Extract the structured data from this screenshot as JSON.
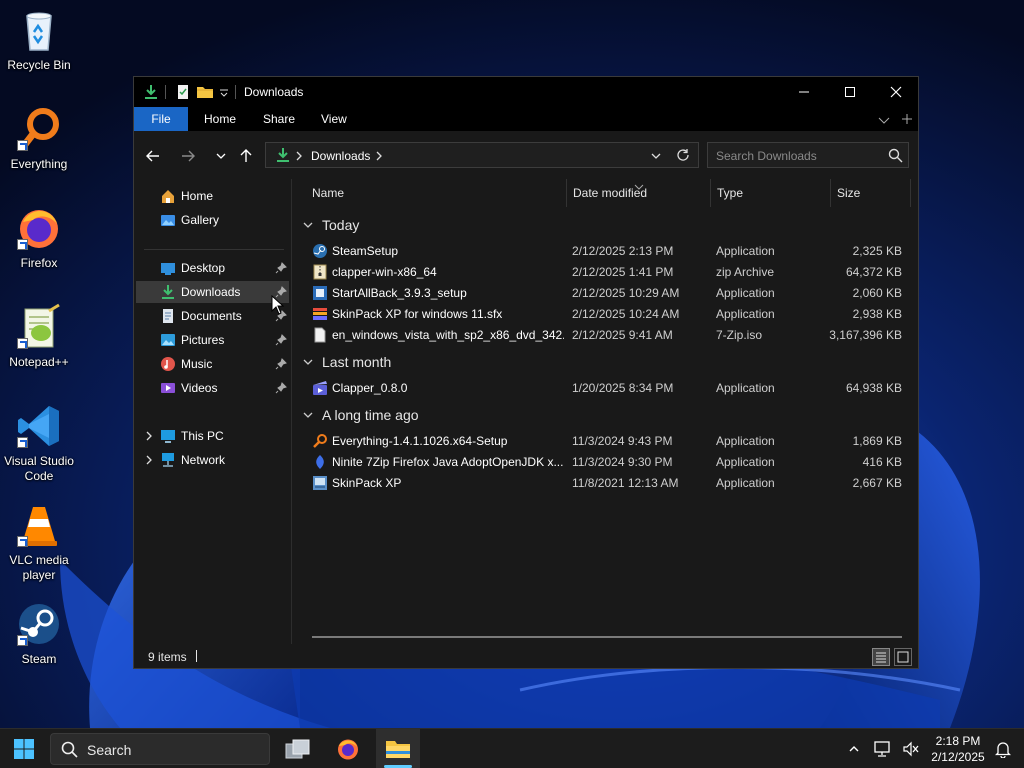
{
  "desktop": {
    "icons": [
      {
        "label": "Recycle Bin",
        "icon": "recycle-bin-icon"
      },
      {
        "label": "Everything",
        "icon": "everything-icon"
      },
      {
        "label": "Firefox",
        "icon": "firefox-icon"
      },
      {
        "label": "Notepad++",
        "icon": "notepad-plus-plus-icon"
      },
      {
        "label": "Visual Studio Code",
        "icon": "vscode-icon"
      },
      {
        "label": "VLC media player",
        "icon": "vlc-icon"
      },
      {
        "label": "Steam",
        "icon": "steam-icon"
      }
    ]
  },
  "window": {
    "title": "Downloads",
    "controls": {
      "minimize": "minimize-icon",
      "maximize": "maximize-icon",
      "close": "close-icon"
    }
  },
  "ribbon": {
    "tabs": [
      "File",
      "Home",
      "Share",
      "View"
    ]
  },
  "address": {
    "path": [
      "Downloads"
    ],
    "search_placeholder": "Search Downloads"
  },
  "nav": {
    "items": [
      {
        "label": "Home",
        "icon": "home-icon"
      },
      {
        "label": "Gallery",
        "icon": "gallery-icon"
      },
      {
        "label": "Desktop",
        "icon": "desktop-folder-icon",
        "pinned": true
      },
      {
        "label": "Downloads",
        "icon": "downloads-folder-icon",
        "pinned": true,
        "selected": true
      },
      {
        "label": "Documents",
        "icon": "documents-folder-icon",
        "pinned": true
      },
      {
        "label": "Pictures",
        "icon": "pictures-folder-icon",
        "pinned": true
      },
      {
        "label": "Music",
        "icon": "music-folder-icon",
        "pinned": true
      },
      {
        "label": "Videos",
        "icon": "videos-folder-icon",
        "pinned": true
      },
      {
        "label": "This PC",
        "icon": "this-pc-icon"
      },
      {
        "label": "Network",
        "icon": "network-icon"
      }
    ]
  },
  "columns": {
    "name": "Name",
    "date": "Date modified",
    "type": "Type",
    "size": "Size"
  },
  "groups": [
    {
      "label": "Today",
      "files": [
        {
          "name": "SteamSetup",
          "date": "2/12/2025 2:13 PM",
          "type": "Application",
          "size": "2,325 KB",
          "icon": "steam-setup-icon"
        },
        {
          "name": "clapper-win-x86_64",
          "date": "2/12/2025 1:41 PM",
          "type": "zip Archive",
          "size": "64,372 KB",
          "icon": "zip-archive-icon"
        },
        {
          "name": "StartAllBack_3.9.3_setup",
          "date": "2/12/2025 10:29 AM",
          "type": "Application",
          "size": "2,060 KB",
          "icon": "startallback-icon"
        },
        {
          "name": "SkinPack XP for windows 11.sfx",
          "date": "2/12/2025 10:24 AM",
          "type": "Application",
          "size": "2,938 KB",
          "icon": "skinpack-sfx-icon"
        },
        {
          "name": "en_windows_vista_with_sp2_x86_dvd_342...",
          "date": "2/12/2025 9:41 AM",
          "type": "7-Zip.iso",
          "size": "3,167,396 KB",
          "icon": "iso-file-icon"
        }
      ]
    },
    {
      "label": "Last month",
      "files": [
        {
          "name": "Clapper_0.8.0",
          "date": "1/20/2025 8:34 PM",
          "type": "Application",
          "size": "64,938 KB",
          "icon": "clapper-icon"
        }
      ]
    },
    {
      "label": "A long time ago",
      "files": [
        {
          "name": "Everything-1.4.1.1026.x64-Setup",
          "date": "11/3/2024 9:43 PM",
          "type": "Application",
          "size": "1,869 KB",
          "icon": "everything-setup-icon"
        },
        {
          "name": "Ninite 7Zip Firefox Java AdoptOpenJDK x...",
          "date": "11/3/2024 9:30 PM",
          "type": "Application",
          "size": "416 KB",
          "icon": "ninite-icon"
        },
        {
          "name": "SkinPack XP",
          "date": "11/8/2021 12:13 AM",
          "type": "Application",
          "size": "2,667 KB",
          "icon": "skinpack-icon"
        }
      ]
    }
  ],
  "status": {
    "count": "9 items"
  },
  "taskbar": {
    "search_label": "Search",
    "apps": [
      "task-view-icon",
      "firefox-icon",
      "file-explorer-icon"
    ],
    "time": "2:18 PM",
    "date": "2/12/2025"
  },
  "colors": {
    "accent": "#1a66c5",
    "window_bg": "#191919",
    "selected": "#3a3a3a",
    "taskbar_indicator": "#60cdff"
  }
}
